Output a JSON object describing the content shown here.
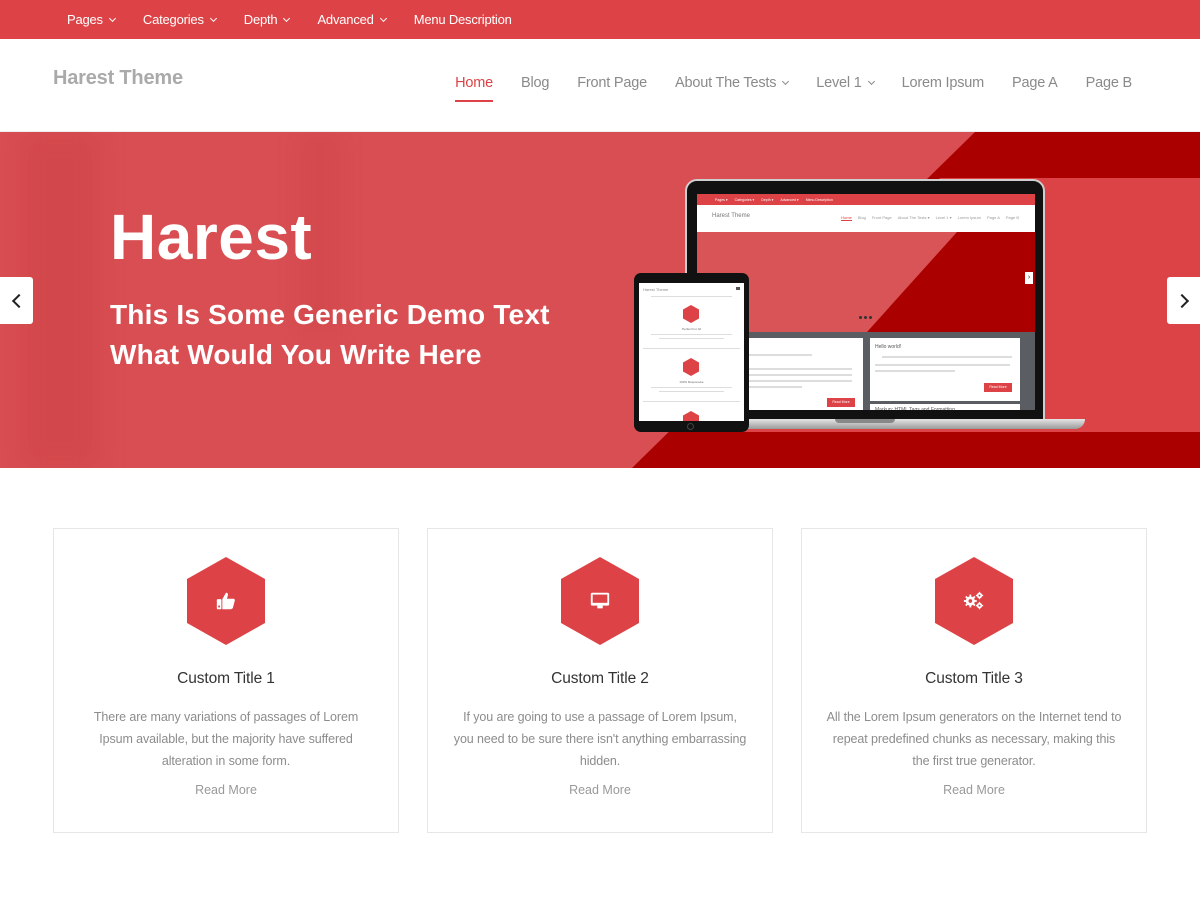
{
  "topbar": {
    "items": [
      {
        "label": "Pages",
        "has_dropdown": true
      },
      {
        "label": "Categories",
        "has_dropdown": true
      },
      {
        "label": "Depth",
        "has_dropdown": true
      },
      {
        "label": "Advanced",
        "has_dropdown": true
      },
      {
        "label": "Menu Description",
        "has_dropdown": false
      }
    ]
  },
  "header": {
    "site_title": "Harest Theme",
    "nav": [
      {
        "label": "Home",
        "active": true,
        "has_dropdown": false
      },
      {
        "label": "Blog",
        "active": false,
        "has_dropdown": false
      },
      {
        "label": "Front Page",
        "active": false,
        "has_dropdown": false
      },
      {
        "label": "About The Tests",
        "active": false,
        "has_dropdown": true
      },
      {
        "label": "Level 1",
        "active": false,
        "has_dropdown": true
      },
      {
        "label": "Lorem Ipsum",
        "active": false,
        "has_dropdown": false
      },
      {
        "label": "Page A",
        "active": false,
        "has_dropdown": false
      },
      {
        "label": "Page B",
        "active": false,
        "has_dropdown": false
      }
    ]
  },
  "hero": {
    "title": "Harest",
    "subtitle_line1": "This Is Some Generic Demo Text",
    "subtitle_line2": "What Would You Write Here",
    "prev_icon": "chevron-left-icon",
    "next_icon": "chevron-right-icon",
    "mockup": {
      "topbar_items": [
        "Pages ▾",
        "Categories ▾",
        "Depth ▾",
        "Advanced ▾",
        "Menu Description"
      ],
      "site_title": "Harest Theme",
      "nav": [
        "Home",
        "Blog",
        "Front Page",
        "About The Tests ▾",
        "Level 1 ▾",
        "Lorem Ipsum",
        "Page A",
        "Page B"
      ],
      "post_1_title": "Hello world!",
      "post_2_title": "Markup: HTML Tags and Formatting",
      "read_more": "Read More",
      "tablet_title": "Harest Theme",
      "tablet_feature_1": "Perfect For All",
      "tablet_feature_2": "100% Responsive"
    }
  },
  "colors": {
    "accent": "#dd4346",
    "dark_accent": "#ab0000",
    "site_title": "#aaaaaa",
    "nav_text": "#8a8a8a"
  },
  "features": [
    {
      "icon": "thumbs-up-icon",
      "title": "Custom Title 1",
      "description": "There are many variations of passages of Lorem Ipsum available, but the majority have suffered alteration in some form.",
      "link": "Read More"
    },
    {
      "icon": "desktop-icon",
      "title": "Custom Title 2",
      "description": "If you are going to use a passage of Lorem Ipsum, you need to be sure there isn't anything embarrassing hidden.",
      "link": "Read More"
    },
    {
      "icon": "gears-icon",
      "title": "Custom Title 3",
      "description": "All the Lorem Ipsum generators on the Internet tend to repeat predefined chunks as necessary, making this the first true generator.",
      "link": "Read More"
    }
  ]
}
